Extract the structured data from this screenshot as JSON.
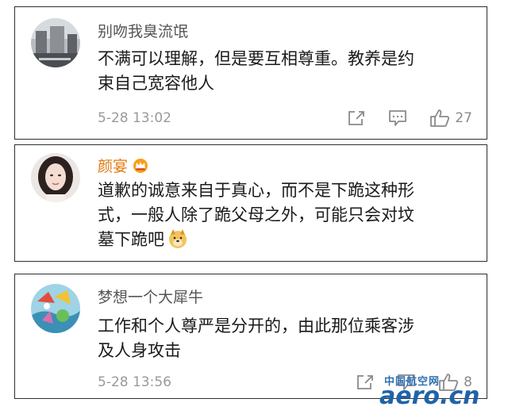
{
  "comments": [
    {
      "username": "别吻我臭流氓",
      "content_lines": [
        "不满可以理解，但是要互相尊重。教养是约",
        "束自己宽容他人"
      ],
      "timestamp": "5-28 13:02",
      "like_count": "27",
      "icons": [
        "share-icon",
        "comment-icon",
        "like-icon"
      ]
    },
    {
      "username": "颜宴",
      "badge_icon": "vip-crown-icon",
      "content_lines": [
        "道歉的诚意来自于真心，而不是下跪这种形",
        "式，一般人除了跪父母之外，可能只会对坟",
        "墓下跪吧"
      ],
      "emoji_icon": "doge-emoji-icon"
    },
    {
      "username": "梦想一个大犀牛",
      "content_lines": [
        "工作和个人尊严是分开的，由此那位乘客涉",
        "及人身攻击"
      ],
      "timestamp": "5-28 13:56",
      "like_count": "8",
      "icons": [
        "share-icon",
        "comment-icon",
        "like-icon"
      ]
    }
  ],
  "watermark": {
    "chinese": "中国航空网",
    "english": "aero.cn"
  },
  "colors": {
    "username": "#555555",
    "vip_username": "#e07a12",
    "text": "#1a1a1a",
    "meta": "#9a9a9a",
    "border": "#2e2e2e",
    "watermark": "#1f63a8"
  }
}
